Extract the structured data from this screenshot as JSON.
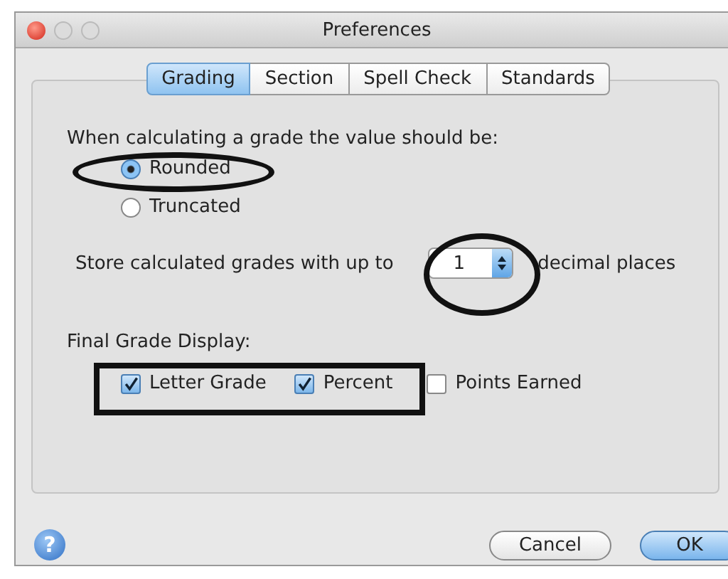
{
  "window": {
    "title": "Preferences"
  },
  "tabs": [
    {
      "label": "Grading",
      "selected": true
    },
    {
      "label": "Section",
      "selected": false
    },
    {
      "label": "Spell Check",
      "selected": false
    },
    {
      "label": "Standards",
      "selected": false
    }
  ],
  "rounding": {
    "label": "When calculating a grade the value should be:",
    "options": [
      {
        "label": "Rounded",
        "selected": true
      },
      {
        "label": "Truncated",
        "selected": false
      }
    ]
  },
  "decimals": {
    "label_before": "Store calculated grades with up to",
    "value": "1",
    "label_after": "decimal places"
  },
  "final_grade_display": {
    "label": "Final Grade Display:",
    "options": [
      {
        "label": "Letter Grade",
        "checked": true
      },
      {
        "label": "Percent",
        "checked": true
      },
      {
        "label": "Points Earned",
        "checked": false
      }
    ]
  },
  "help_button": {
    "label": "?"
  },
  "buttons": [
    {
      "label": "Cancel",
      "default": false
    },
    {
      "label": "OK",
      "default": true
    }
  ]
}
